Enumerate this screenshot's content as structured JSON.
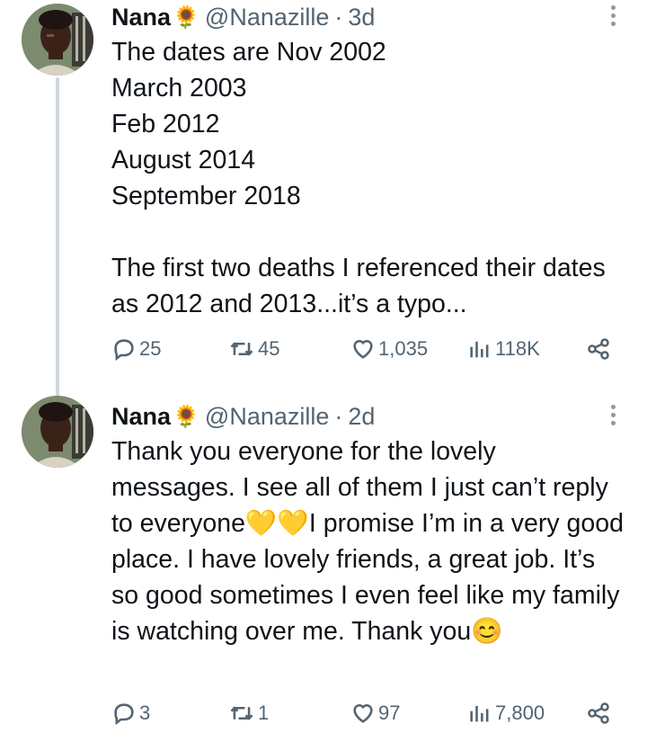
{
  "tweets": [
    {
      "author": "Nana",
      "author_emoji": "🌻",
      "handle": "@Nanazille",
      "sep": "·",
      "time": "3d",
      "text": "The dates are Nov 2002\nMarch 2003\nFeb 2012\nAugust 2014\nSeptember 2018\n\nThe first two deaths I referenced their dates as 2012 and 2013...it’s a typo...",
      "replies": "25",
      "reposts": "45",
      "likes": "1,035",
      "views": "118K"
    },
    {
      "author": "Nana",
      "author_emoji": "🌻",
      "handle": "@Nanazille",
      "sep": "·",
      "time": "2d",
      "text": "Thank you everyone for the lovely messages. I see all of them I just can’t reply to everyone💛💛I promise I’m in a very good place. I have lovely friends, a great job. It’s so good sometimes I even feel like my family is watching over me. Thank you😊",
      "replies": "3",
      "reposts": "1",
      "likes": "97",
      "views": "7,800"
    }
  ]
}
